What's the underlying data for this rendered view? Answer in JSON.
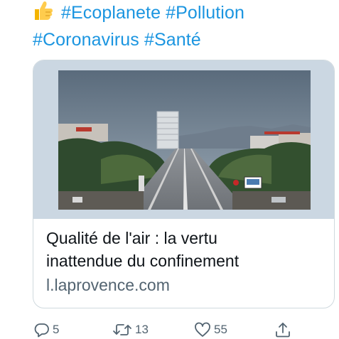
{
  "tweet": {
    "hashtags": [
      "#Ecoplanete",
      "#Pollution",
      "#Coronavirus",
      "#Santé"
    ],
    "emoji": "thumbs-up-emoji"
  },
  "card": {
    "image_icon": "city-boulevard-photo",
    "title_line1": "Qualité de l'air : la vertu",
    "title_line2": "inattendue du confinement",
    "domain": "l.laprovence.com"
  },
  "actions": {
    "reply_count": "5",
    "retweet_count": "13",
    "like_count": "55"
  },
  "colors": {
    "link": "#1b95e0",
    "muted": "#536471",
    "text": "#0f1419",
    "border": "#cfd9de"
  }
}
